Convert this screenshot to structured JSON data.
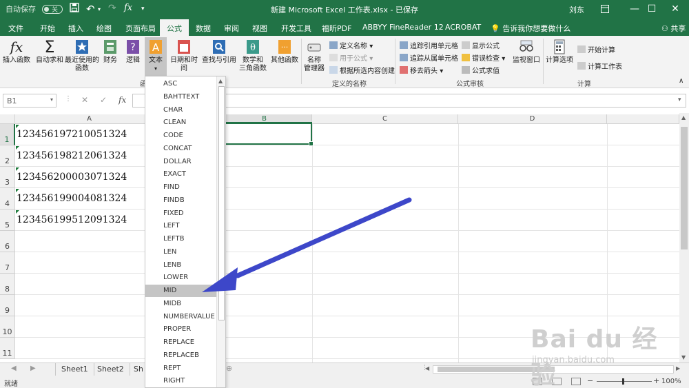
{
  "titlebar": {
    "autosave_label": "自动保存",
    "autosave_state": "关",
    "doc_title": "新建 Microsoft Excel 工作表.xlsx  -  已保存",
    "user": "刘东"
  },
  "ribbon_tabs": [
    "文件",
    "开始",
    "插入",
    "绘图",
    "页面布局",
    "公式",
    "数据",
    "审阅",
    "视图",
    "开发工具",
    "福昕PDF",
    "ABBYY FineReader 12",
    "ACROBAT"
  ],
  "active_tab": "公式",
  "tell_me": "告诉我你想要做什么",
  "share": "共享",
  "ribbon": {
    "insert_function": "插入函数",
    "autosum": "自动求和",
    "recent": "最近使用的\n函数",
    "financial": "财务",
    "logical": "逻辑",
    "text": "文本",
    "datetime": "日期和时间",
    "lookup": "查找与引用",
    "math": "数学和\n三角函数",
    "more": "其他函数",
    "name_manager": "名称\n管理器",
    "define_name": "定义名称",
    "use_in_formula": "用于公式",
    "create_from_selection": "根据所选内容创建",
    "defined_names_group": "定义的名称",
    "trace_precedents": "追踪引用单元格",
    "trace_dependents": "追踪从属单元格",
    "remove_arrows": "移去箭头",
    "show_formulas": "显示公式",
    "error_checking": "错误检查",
    "evaluate_formula": "公式求值",
    "formula_auditing_group": "公式审核",
    "watch_window": "监视窗口",
    "calc_options": "计算选项",
    "calc_now": "开始计算",
    "calc_sheet": "计算工作表",
    "calculation_group": "计算",
    "library_group_partial": "函"
  },
  "formula_bar": {
    "name_box": "B1",
    "fx": "fx"
  },
  "columns": [
    "A",
    "B",
    "C",
    "D"
  ],
  "rows": [
    "1",
    "2",
    "3",
    "4",
    "5",
    "6",
    "7",
    "8",
    "9",
    "10",
    "11"
  ],
  "cells_A": [
    "123456197210051324",
    "123456198212061324",
    "123456200003071324",
    "123456199004081324",
    "123456199512091324"
  ],
  "text_functions": [
    "ASC",
    "BAHTTEXT",
    "CHAR",
    "CLEAN",
    "CODE",
    "CONCAT",
    "DOLLAR",
    "EXACT",
    "FIND",
    "FINDB",
    "FIXED",
    "LEFT",
    "LEFTB",
    "LEN",
    "LENB",
    "LOWER",
    "MID",
    "MIDB",
    "NUMBERVALUE",
    "PROPER",
    "REPLACE",
    "REPLACEB",
    "REPT",
    "RIGHT"
  ],
  "highlighted_function": "MID",
  "sheets": [
    "Sheet1",
    "Sheet2",
    "Sh"
  ],
  "status": {
    "ready": "就绪",
    "zoom": "100%"
  },
  "watermark": {
    "brand": "Bai du 经验",
    "url": "jingyan.baidu.com"
  },
  "colors": {
    "excel_green": "#217346",
    "arrow_blue": "#3d47c9",
    "hover_gray": "#c5c5c5"
  }
}
